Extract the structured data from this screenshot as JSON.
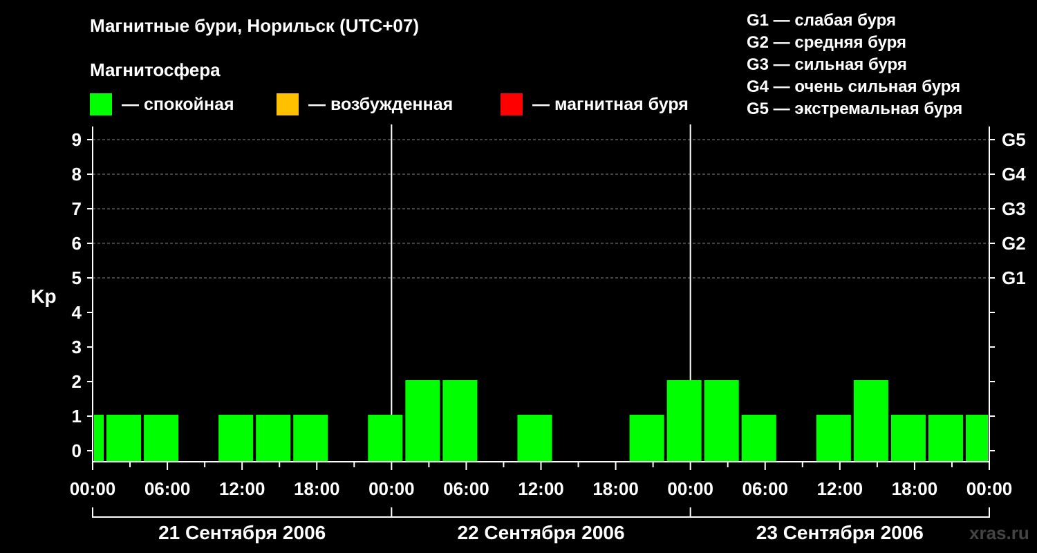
{
  "title": "Магнитные бури, Норильск (UTC+07)",
  "subtitle": "Магнитосфера",
  "legend": [
    {
      "label": "— спокойная",
      "color": "#00ff00"
    },
    {
      "label": "— возбужденная",
      "color": "#ffc000"
    },
    {
      "label": "— магнитная буря",
      "color": "#ff0000"
    }
  ],
  "g_scale": [
    "G1 — слабая буря",
    "G2 — средняя буря",
    "G3 — сильная буря",
    "G4 — очень сильная буря",
    "G5 — экстремальная буря"
  ],
  "watermark": "xras.ru",
  "chart_data": {
    "type": "bar",
    "ylabel": "Kp",
    "ylim": [
      0,
      9
    ],
    "yticks": [
      "0",
      "1",
      "2",
      "3",
      "4",
      "5",
      "6",
      "7",
      "8",
      "9"
    ],
    "right_ticks": [
      {
        "kp": 5,
        "label": "G1"
      },
      {
        "kp": 6,
        "label": "G2"
      },
      {
        "kp": 7,
        "label": "G3"
      },
      {
        "kp": 8,
        "label": "G4"
      },
      {
        "kp": 9,
        "label": "G5"
      }
    ],
    "xticks": [
      "00:00",
      "06:00",
      "12:00",
      "18:00",
      "00:00",
      "06:00",
      "12:00",
      "18:00",
      "00:00",
      "06:00",
      "12:00",
      "18:00",
      "00:00"
    ],
    "days": [
      "21 Сентября 2006",
      "22 Сентября 2006",
      "23 Сентября 2006"
    ],
    "bars_hours": [
      {
        "start": 0,
        "end": 1,
        "kp": 1
      },
      {
        "start": 1,
        "end": 4,
        "kp": 1
      },
      {
        "start": 4,
        "end": 7,
        "kp": 1
      },
      {
        "start": 7,
        "end": 10,
        "kp": 0
      },
      {
        "start": 10,
        "end": 13,
        "kp": 1
      },
      {
        "start": 13,
        "end": 16,
        "kp": 1
      },
      {
        "start": 16,
        "end": 19,
        "kp": 1
      },
      {
        "start": 19,
        "end": 22,
        "kp": 0
      },
      {
        "start": 22,
        "end": 25,
        "kp": 1
      },
      {
        "start": 25,
        "end": 28,
        "kp": 2
      },
      {
        "start": 28,
        "end": 31,
        "kp": 2
      },
      {
        "start": 31,
        "end": 34,
        "kp": 0
      },
      {
        "start": 34,
        "end": 37,
        "kp": 1
      },
      {
        "start": 37,
        "end": 40,
        "kp": 0
      },
      {
        "start": 40,
        "end": 43,
        "kp": 0
      },
      {
        "start": 43,
        "end": 46,
        "kp": 1
      },
      {
        "start": 46,
        "end": 49,
        "kp": 2
      },
      {
        "start": 49,
        "end": 52,
        "kp": 2
      },
      {
        "start": 52,
        "end": 55,
        "kp": 1
      },
      {
        "start": 55,
        "end": 58,
        "kp": 0
      },
      {
        "start": 58,
        "end": 61,
        "kp": 1
      },
      {
        "start": 61,
        "end": 64,
        "kp": 2
      },
      {
        "start": 64,
        "end": 67,
        "kp": 1
      },
      {
        "start": 67,
        "end": 70,
        "kp": 1
      },
      {
        "start": 70,
        "end": 72,
        "kp": 1
      }
    ],
    "bar_color": "#00ff00",
    "grid": true
  }
}
